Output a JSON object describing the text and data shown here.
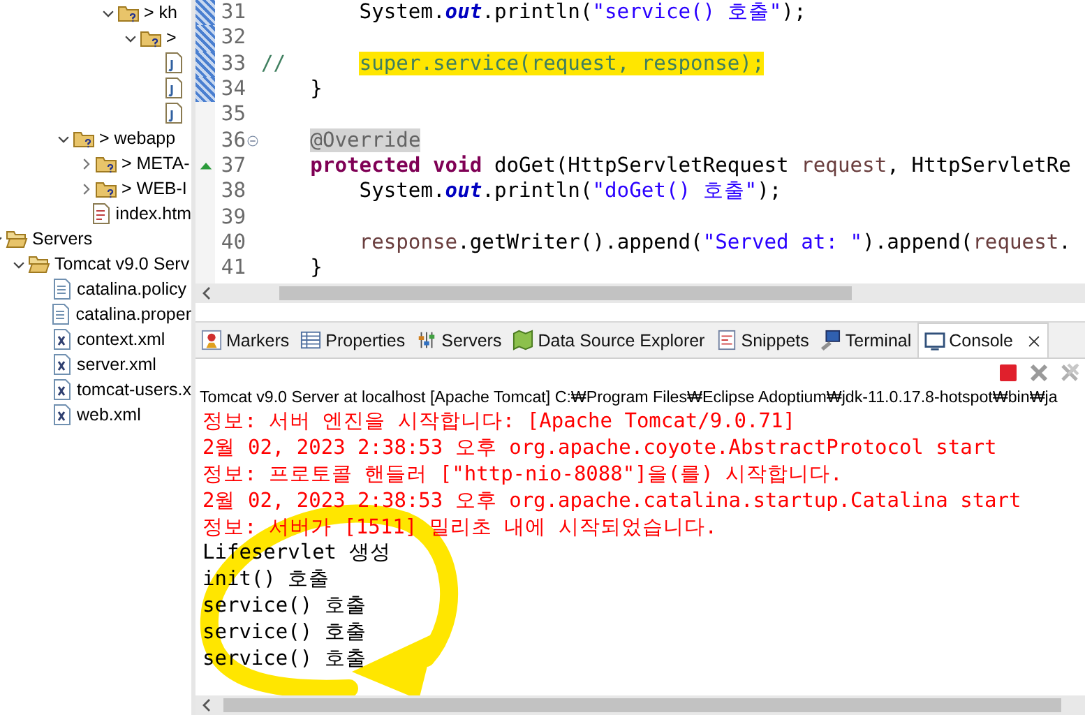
{
  "project_tree": [
    {
      "children": [
        {
          "children": [
            {
              "children": [
                {
                  "children": [
                    {
                      "children": [
                        {
                          "label": "> kh",
                          "kind": "package",
                          "expanded": true,
                          "children": [
                            {
                              "label": ">",
                              "kind": "package",
                              "expanded": true,
                              "children": [
                                {
                                  "kind": "java-file"
                                },
                                {
                                  "kind": "java-file"
                                },
                                {
                                  "kind": "java-file"
                                }
                              ]
                            }
                          ]
                        }
                      ]
                    }
                  ]
                },
                {
                  "label": "> webapp",
                  "kind": "folder",
                  "expanded": true,
                  "children": [
                    {
                      "label": "> META-",
                      "kind": "folder",
                      "expanded": false
                    },
                    {
                      "label": "> WEB-I",
                      "kind": "folder",
                      "expanded": false
                    },
                    {
                      "label": "index.htm",
                      "kind": "html-file"
                    }
                  ]
                }
              ]
            }
          ]
        }
      ]
    },
    {
      "label": "Servers",
      "kind": "open-folder",
      "expanded": true,
      "children": [
        {
          "label": "Tomcat v9.0 Serv",
          "kind": "open-folder",
          "expanded": true,
          "children": [
            {
              "label": "catalina.policy",
              "kind": "text-file"
            },
            {
              "label": "catalina.proper",
              "kind": "text-file"
            },
            {
              "label": "context.xml",
              "kind": "xml-file"
            },
            {
              "label": "server.xml",
              "kind": "xml-file"
            },
            {
              "label": "tomcat-users.x",
              "kind": "xml-file"
            },
            {
              "label": "web.xml",
              "kind": "xml-file"
            }
          ]
        }
      ]
    }
  ],
  "editor": {
    "lines": [
      {
        "number": "31",
        "changed": true,
        "kind": "plain",
        "segments": [
          {
            "text": "        System.",
            "kind": "plain",
            "highlighted": false
          },
          {
            "text": "out",
            "kind": "field",
            "highlighted": false
          },
          {
            "text": ".println(",
            "kind": "plain",
            "highlighted": false
          },
          {
            "text": "\"service() 호출\"",
            "kind": "string",
            "highlighted": false
          },
          {
            "text": ");",
            "kind": "plain",
            "highlighted": false
          }
        ]
      },
      {
        "number": "32",
        "changed": true,
        "kind": "plain"
      },
      {
        "number": "33",
        "changed": true,
        "kind": "plain",
        "segments": [
          {
            "text": "//  ",
            "kind": "comment",
            "highlighted": false
          },
          {
            "text": "    super.service(request, response);",
            "kind": "comment",
            "highlighted": true
          }
        ]
      },
      {
        "number": "34",
        "changed": true,
        "kind": "plain",
        "segments": [
          {
            "text": "    }",
            "kind": "plain",
            "highlighted": false
          }
        ]
      },
      {
        "number": "35",
        "changed": false,
        "kind": "plain"
      },
      {
        "number": "36",
        "changed": false,
        "kind": "fold",
        "segments": [
          {
            "text": "    @Override",
            "kind": "annotation",
            "highlighted": true
          }
        ]
      },
      {
        "number": "37",
        "changed": false,
        "kind": "override",
        "segments": [
          {
            "text": "    protected void",
            "kind": "keyword",
            "highlighted": false
          },
          {
            "text": " doGet(HttpServletRequest ",
            "kind": "plain",
            "highlighted": false
          },
          {
            "text": "request",
            "kind": "param",
            "highlighted": false
          },
          {
            "text": ", HttpServletRe",
            "kind": "plain",
            "highlighted": false
          }
        ]
      },
      {
        "number": "38",
        "changed": false,
        "kind": "plain",
        "segments": [
          {
            "text": "        System.",
            "kind": "plain",
            "highlighted": false
          },
          {
            "text": "out",
            "kind": "field",
            "highlighted": false
          },
          {
            "text": ".println(",
            "kind": "plain",
            "highlighted": false
          },
          {
            "text": "\"doGet() 호출\"",
            "kind": "string",
            "highlighted": false
          },
          {
            "text": ");",
            "kind": "plain",
            "highlighted": false
          }
        ]
      },
      {
        "number": "39",
        "changed": false,
        "kind": "plain"
      },
      {
        "number": "40",
        "changed": false,
        "kind": "plain",
        "segments": [
          {
            "text": "        response",
            "kind": "param",
            "highlighted": false
          },
          {
            "text": ".getWriter().append(",
            "kind": "plain",
            "highlighted": false
          },
          {
            "text": "\"Served at: \"",
            "kind": "string",
            "highlighted": false
          },
          {
            "text": ").append(",
            "kind": "plain",
            "highlighted": false
          },
          {
            "text": "request",
            "kind": "param",
            "highlighted": false
          },
          {
            "text": ".",
            "kind": "plain",
            "highlighted": false
          }
        ]
      },
      {
        "number": "41",
        "changed": false,
        "kind": "plain",
        "segments": [
          {
            "text": "    }",
            "kind": "plain",
            "highlighted": false
          }
        ]
      }
    ]
  },
  "views": {
    "tabs": [
      {
        "label": "Markers",
        "kind": "markers",
        "selected": false
      },
      {
        "label": "Properties",
        "kind": "properties",
        "selected": false
      },
      {
        "label": "Servers",
        "kind": "servers",
        "selected": false
      },
      {
        "label": "Data Source Explorer",
        "kind": "datasource",
        "selected": false
      },
      {
        "label": "Snippets",
        "kind": "snippets",
        "selected": false
      },
      {
        "label": "Terminal",
        "kind": "terminal",
        "selected": false
      },
      {
        "label": "Console",
        "kind": "console",
        "selected": true
      }
    ],
    "console_title": "Tomcat v9.0 Server at localhost [Apache Tomcat] C:₩Program Files₩Eclipse Adoptium₩jdk-11.0.17.8-hotspot₩bin₩ja",
    "console_lines": [
      {
        "text": "정보: 서버 엔진을 시작합니다: [Apache Tomcat/9.0.71]",
        "kind": "err"
      },
      {
        "text": "2월 02, 2023 2:38:53 오후 org.apache.coyote.AbstractProtocol start",
        "kind": "err"
      },
      {
        "text": "정보: 프로토콜 핸들러 [\"http-nio-8088\"]을(를) 시작합니다.",
        "kind": "err"
      },
      {
        "text": "2월 02, 2023 2:38:53 오후 org.apache.catalina.startup.Catalina start",
        "kind": "err"
      },
      {
        "text": "정보: 서버가 [1511] 밀리초 내에 시작되었습니다.",
        "kind": "err"
      },
      {
        "text": "Lifeservlet 생성",
        "kind": "out"
      },
      {
        "text": "init() 호출",
        "kind": "out"
      },
      {
        "text": "service() 호출",
        "kind": "out"
      },
      {
        "text": "service() 호출",
        "kind": "out"
      },
      {
        "text": "service() 호출",
        "kind": "out"
      }
    ]
  }
}
